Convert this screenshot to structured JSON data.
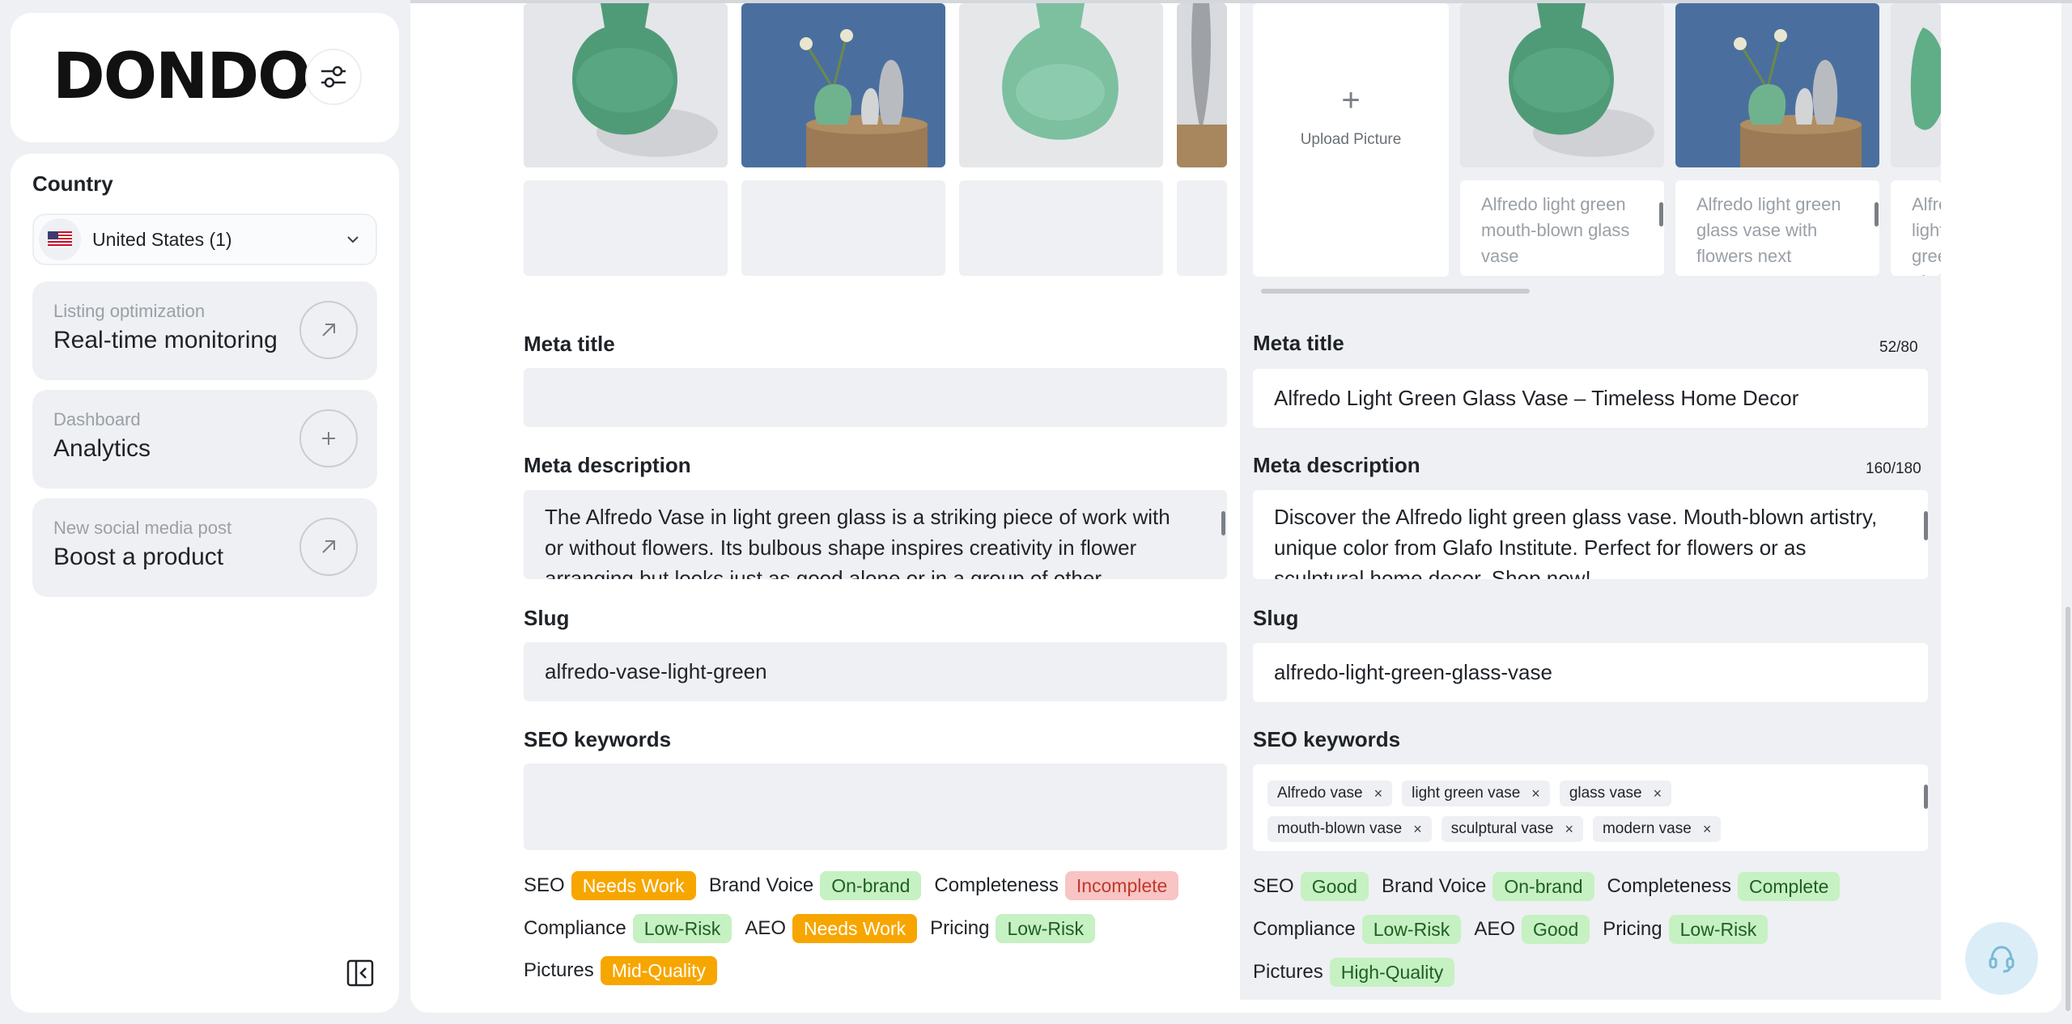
{
  "sidebar": {
    "logo": "DONDO",
    "country_label": "Country",
    "country_value": "United States (1)",
    "nav": [
      {
        "sub": "Listing optimization",
        "main": "Real-time monitoring",
        "icon": "arrow-up-right-icon"
      },
      {
        "sub": "Dashboard",
        "main": "Analytics",
        "icon": "plus-icon"
      },
      {
        "sub": "New social media post",
        "main": "Boost a product",
        "icon": "arrow-up-right-icon"
      }
    ]
  },
  "left": {
    "meta_title_label": "Meta title",
    "meta_title_value": "",
    "meta_desc_label": "Meta description",
    "meta_desc_value": "The Alfredo Vase in light green glass is a striking piece of work with or without flowers. Its bulbous shape inspires creativity in flower arranging but looks just as good alone or in a group of other",
    "slug_label": "Slug",
    "slug_value": "alfredo-vase-light-green",
    "keywords_label": "SEO keywords",
    "stats": [
      [
        {
          "label": "SEO",
          "badge": "Needs Work",
          "tone": "orange"
        },
        {
          "label": "Brand Voice",
          "badge": "On-brand",
          "tone": "green"
        },
        {
          "label": "Completeness",
          "badge": "Incomplete",
          "tone": "red"
        }
      ],
      [
        {
          "label": "Compliance",
          "badge": "Low-Risk",
          "tone": "green"
        },
        {
          "label": "AEO",
          "badge": "Needs Work",
          "tone": "orange"
        },
        {
          "label": "Pricing",
          "badge": "Low-Risk",
          "tone": "green"
        }
      ],
      [
        {
          "label": "Pictures",
          "badge": "Mid-Quality",
          "tone": "orange"
        }
      ]
    ]
  },
  "right": {
    "upload_label": "Upload Picture",
    "captions": [
      "Alfredo light green mouth-blown glass vase",
      "Alfredo light green glass vase with flowers next",
      "Alfredo light green glass vase with"
    ],
    "meta_title_label": "Meta title",
    "meta_title_counter": "52/80",
    "meta_title_value": "Alfredo Light Green Glass Vase – Timeless Home Decor",
    "meta_desc_label": "Meta description",
    "meta_desc_counter": "160/180",
    "meta_desc_value": "Discover the Alfredo light green glass vase. Mouth-blown artistry, unique color from Glafo Institute. Perfect for flowers or as sculptural home decor. Shop now!",
    "slug_label": "Slug",
    "slug_value": "alfredo-light-green-glass-vase",
    "keywords_label": "SEO keywords",
    "keywords": [
      "Alfredo vase",
      "light green vase",
      "glass vase",
      "mouth-blown vase",
      "sculptural vase",
      "modern vase"
    ],
    "stats": [
      [
        {
          "label": "SEO",
          "badge": "Good",
          "tone": "green"
        },
        {
          "label": "Brand Voice",
          "badge": "On-brand",
          "tone": "green"
        },
        {
          "label": "Completeness",
          "badge": "Complete",
          "tone": "green"
        }
      ],
      [
        {
          "label": "Compliance",
          "badge": "Low-Risk",
          "tone": "green"
        },
        {
          "label": "AEO",
          "badge": "Good",
          "tone": "green"
        },
        {
          "label": "Pricing",
          "badge": "Low-Risk",
          "tone": "green"
        }
      ],
      [
        {
          "label": "Pictures",
          "badge": "High-Quality",
          "tone": "green"
        }
      ]
    ]
  },
  "colors": {
    "orange": "#f7a600",
    "green_bg": "#c6f1c2",
    "red_bg": "#f8c4c4"
  }
}
